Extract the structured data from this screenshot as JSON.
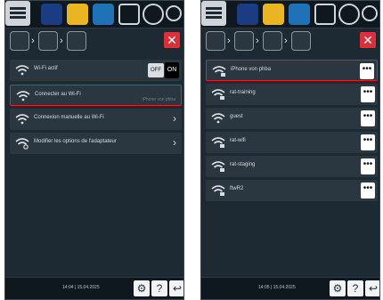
{
  "left_panel": {
    "top_icons": [
      "menu-icon",
      "chef-icon",
      "folder-icon",
      "recipe-icon",
      "edit-icon",
      "settings-icon",
      "search-icon"
    ],
    "breadcrumb": [
      "settings",
      "network",
      "wifi"
    ],
    "items": [
      {
        "label": "Wi-Fi actif",
        "toggle_off": "OFF",
        "toggle_on": "ON"
      },
      {
        "label": "Connecter au Wi-Fi",
        "value": "iPhone von phba"
      },
      {
        "label": "Connexion manuelle au Wi-Fi"
      },
      {
        "label": "Modifier les options de l'adaptateur"
      }
    ],
    "footer": {
      "datetime": "14:04 | 15.04.2025"
    }
  },
  "right_panel": {
    "top_icons": [
      "menu-icon",
      "chef-icon",
      "folder-icon",
      "recipe-icon",
      "edit-icon",
      "settings-icon",
      "search-icon"
    ],
    "breadcrumb": [
      "settings",
      "network",
      "wifi",
      "wifi"
    ],
    "networks": [
      {
        "name": "iPhone von phba"
      },
      {
        "name": "rat-training"
      },
      {
        "name": "guest"
      },
      {
        "name": "rat-wifi"
      },
      {
        "name": "rat-staging"
      },
      {
        "name": "ftwR2"
      }
    ],
    "footer": {
      "datetime": "14:05 | 15.04.2025"
    }
  },
  "colors": {
    "panel_bg": "#1e2a33",
    "row_bg": "#2a3640",
    "accent_red": "#e0202a",
    "text": "#d7dde2"
  }
}
